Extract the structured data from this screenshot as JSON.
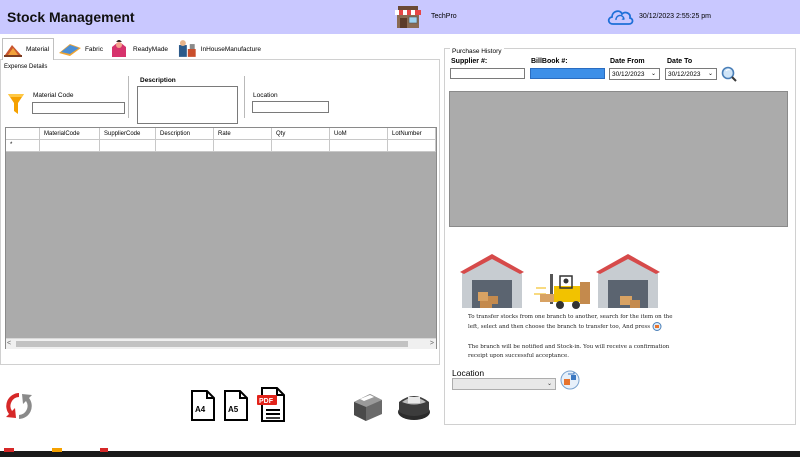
{
  "header": {
    "app_title": "Stock Management",
    "store_name": "TechPro",
    "datetime": "30/12/2023 2:55:25 pm"
  },
  "tabs": [
    {
      "label": "Material",
      "icon": "material-icon"
    },
    {
      "label": "Fabric",
      "icon": "fabric-icon"
    },
    {
      "label": "ReadyMade",
      "icon": "readymade-icon"
    },
    {
      "label": "InHouseManufacture",
      "icon": "inhouse-manufacture-icon"
    }
  ],
  "expense": {
    "section_label": "Expense Details",
    "material_code_label": "Material Code",
    "material_code_value": "",
    "description_label": "Description",
    "description_value": "",
    "location_label": "Location",
    "location_value": ""
  },
  "grid": {
    "columns": [
      "MaterialCode",
      "SupplierCode",
      "Description",
      "Rate",
      "Qty",
      "UoM",
      "LotNumber"
    ],
    "new_row_marker": "*"
  },
  "purchase_history": {
    "section_label": "Purchase History",
    "supplier_label": "Supplier #:",
    "billbook_label": "BillBook #:",
    "date_from_label": "Date From",
    "date_to_label": "Date To",
    "date_from_value": "30/12/2023",
    "date_to_value": "30/12/2023"
  },
  "transfer_info": {
    "text_1a": "To transfer stocks from one branch to another, search for the item on the left, select and then choose the branch to transfer too, And press",
    "text_2": "The branch will be notified and Stock-in. You will receive a confirmation receipt upon successful acceptance.",
    "location_label": "Location",
    "location_value": ""
  },
  "print_options": {
    "a4_label": "A4",
    "a5_label": "A5",
    "pdf_label": "PDF"
  },
  "colors": {
    "header_bg": "#c9c8ff",
    "billbook_highlight": "#3d8fe8",
    "grid_bg": "#ababab"
  }
}
